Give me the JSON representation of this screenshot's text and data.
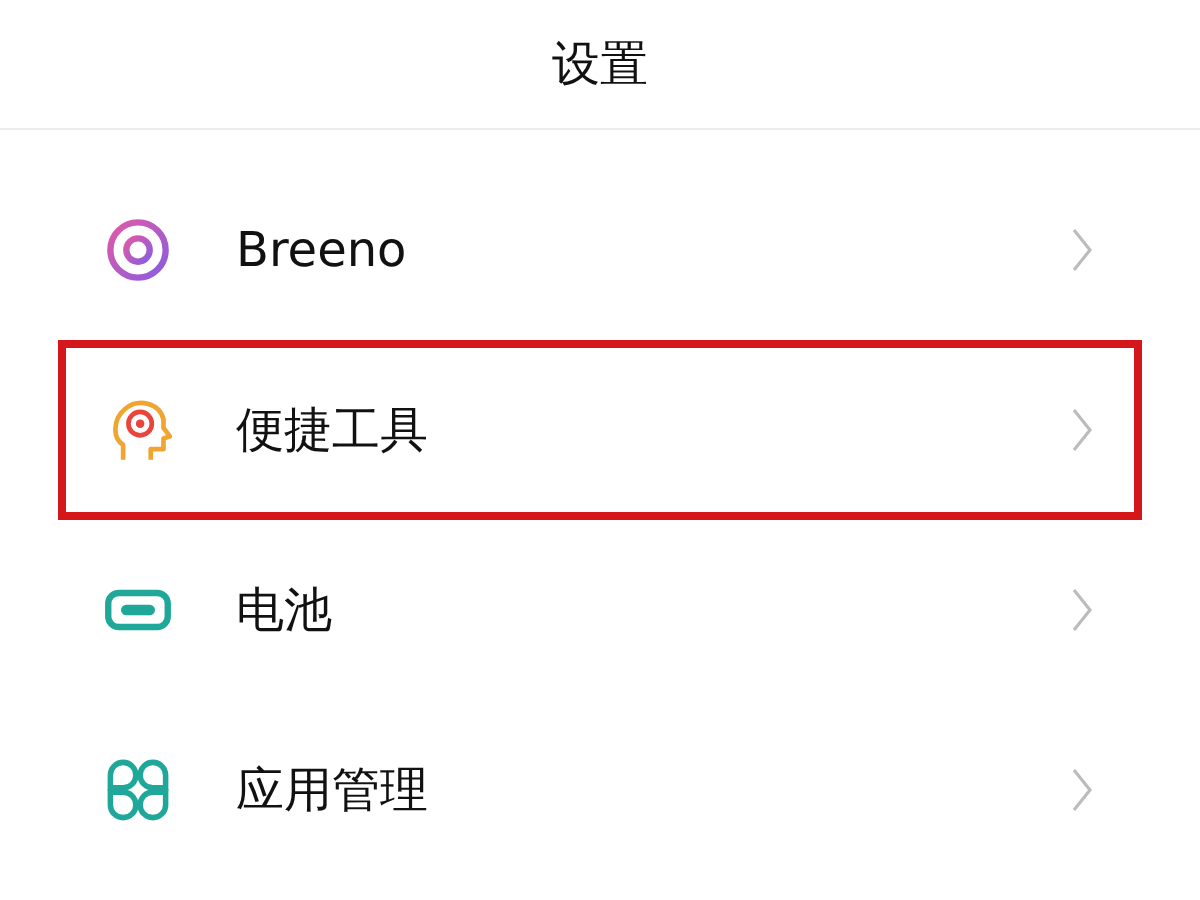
{
  "header": {
    "title": "设置"
  },
  "items": [
    {
      "label": "Breeno",
      "highlighted": false
    },
    {
      "label": "便捷工具",
      "highlighted": true
    },
    {
      "label": "电池",
      "highlighted": false
    },
    {
      "label": "应用管理",
      "highlighted": false
    }
  ]
}
